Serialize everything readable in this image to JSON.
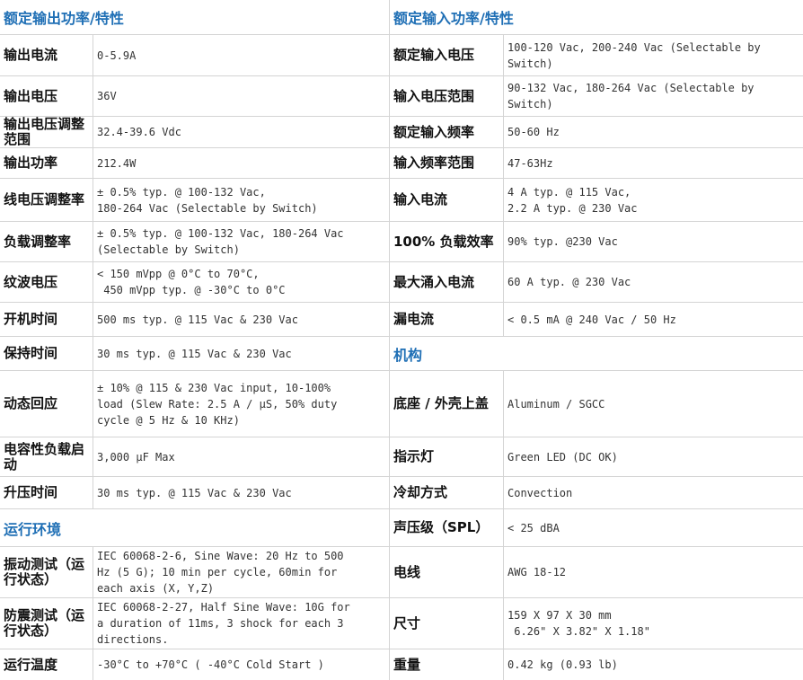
{
  "output": {
    "title": "额定输出功率/特性",
    "rows": [
      {
        "label": "输出电流",
        "value": "0-5.9A"
      },
      {
        "label": "输出电压",
        "value": "36V"
      },
      {
        "label": "输出电压调整范围",
        "value": "32.4-39.6 Vdc"
      },
      {
        "label": "输出功率",
        "value": "212.4W"
      },
      {
        "label": "线电压调整率",
        "value": "± 0.5% typ. @ 100-132 Vac,\n180-264 Vac (Selectable by Switch)"
      },
      {
        "label": "负载调整率",
        "value": "± 0.5% typ. @ 100-132 Vac, 180-264 Vac\n(Selectable by Switch)"
      },
      {
        "label": "纹波电压",
        "value": "< 150 mVpp @ 0°C to 70°C,\n 450 mVpp typ. @ -30°C to 0°C"
      },
      {
        "label": "开机时间",
        "value": "500 ms typ. @ 115 Vac & 230 Vac"
      },
      {
        "label": "保持时间",
        "value": "30 ms typ. @ 115 Vac & 230 Vac"
      },
      {
        "label": "动态回应",
        "value": "± 10% @ 115 & 230 Vac input, 10-100%\nload (Slew Rate: 2.5 A / μS, 50% duty\ncycle @ 5 Hz & 10 KHz)"
      },
      {
        "label": "电容性负载启动",
        "value": "3,000 μF Max"
      },
      {
        "label": "升压时间",
        "value": "30 ms typ. @ 115 Vac & 230 Vac"
      }
    ]
  },
  "environment": {
    "title": "运行环境",
    "rows": [
      {
        "label": "振动测试（运行状态）",
        "value": "IEC 60068-2-6, Sine Wave: 20 Hz to 500\nHz (5 G); 10 min per cycle, 60min for\neach axis (X, Y,Z)"
      },
      {
        "label": "防震测试（运行状态）",
        "value": "IEC 60068-2-27, Half Sine Wave: 10G for\na duration of 11ms, 3 shock for each 3\ndirections."
      },
      {
        "label": "运行温度",
        "value": "-30°C to +70°C ( -40°C Cold Start )"
      }
    ]
  },
  "input": {
    "title": "额定输入功率/特性",
    "rows": [
      {
        "label": "额定输入电压",
        "value": "100-120 Vac, 200-240 Vac (Selectable by\nSwitch)"
      },
      {
        "label": "输入电压范围",
        "value": "90-132 Vac, 180-264 Vac (Selectable by\nSwitch)"
      },
      {
        "label": "额定输入频率",
        "value": "50-60 Hz"
      },
      {
        "label": "输入频率范围",
        "value": "47-63Hz"
      },
      {
        "label": "输入电流",
        "value": "4 A typ. @ 115 Vac,\n2.2 A typ. @ 230 Vac"
      },
      {
        "label": "100% 负载效率",
        "value": "90% typ. @230 Vac"
      },
      {
        "label": "最大涌入电流",
        "value": "60 A typ. @ 230 Vac"
      },
      {
        "label": "漏电流",
        "value": "< 0.5 mA @ 240 Vac / 50 Hz"
      }
    ]
  },
  "mechanical": {
    "title": "机构",
    "rows": [
      {
        "label": "底座 / 外壳上盖",
        "value": "Aluminum / SGCC"
      },
      {
        "label": "指示灯",
        "value": "Green LED (DC OK)"
      },
      {
        "label": "冷却方式",
        "value": "Convection"
      },
      {
        "label": "声压级（SPL）",
        "value": "< 25 dBA"
      },
      {
        "label": "电线",
        "value": "AWG 18-12"
      },
      {
        "label": "尺寸",
        "value": "159 X 97 X 30 mm\n 6.26\" X 3.82\" X 1.18\""
      },
      {
        "label": "重量",
        "value": "0.42 kg (0.93 lb)"
      }
    ]
  }
}
